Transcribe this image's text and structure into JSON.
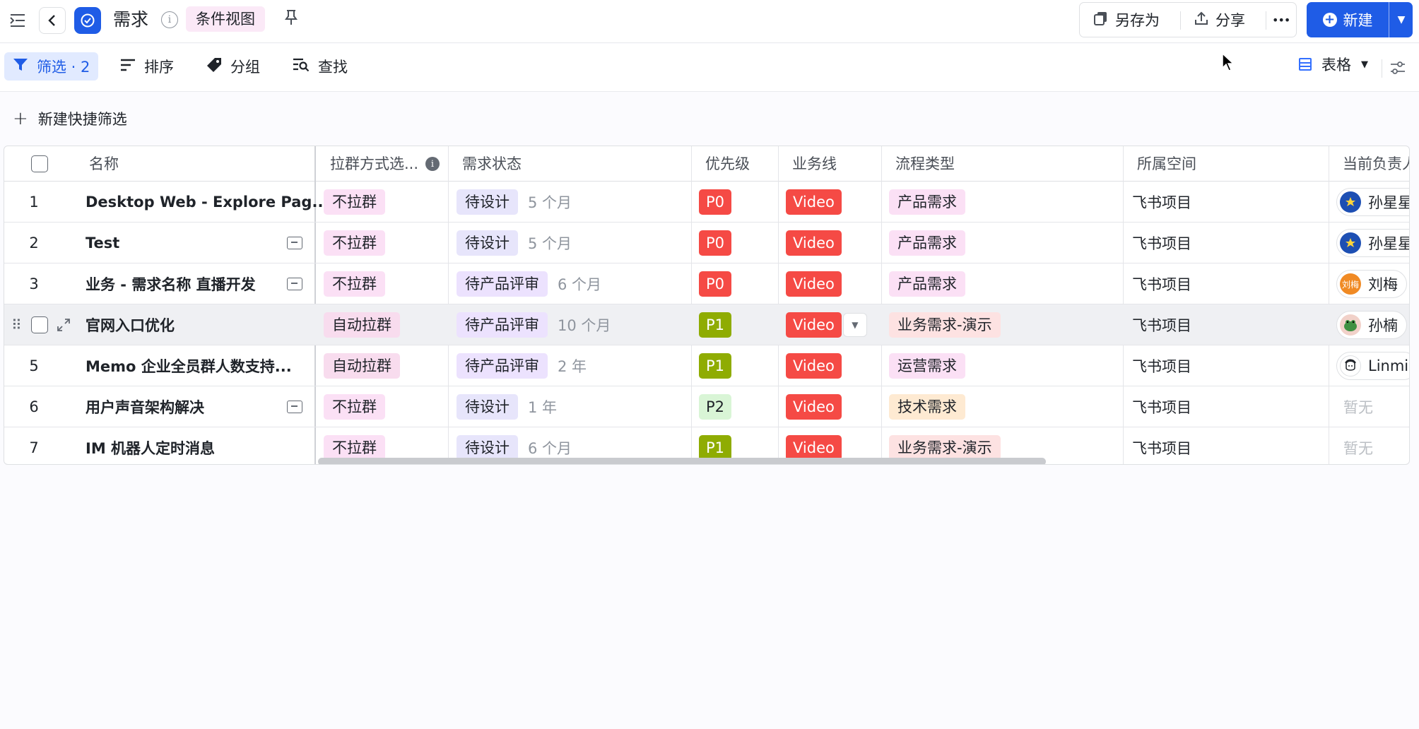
{
  "header": {
    "title": "需求",
    "view_name": "条件视图",
    "save_as": "另存为",
    "share": "分享",
    "more": "•••",
    "new": "新建"
  },
  "toolbar": {
    "filter": "筛选 · 2",
    "sort": "排序",
    "group": "分组",
    "find": "查找",
    "view_type": "表格"
  },
  "quick_filter": {
    "label": "新建快捷筛选"
  },
  "table": {
    "columns": [
      "名称",
      "拉群方式选...",
      "需求状态",
      "优先级",
      "业务线",
      "流程类型",
      "所属空间",
      "当前负责人"
    ],
    "rows": [
      {
        "idx": "1",
        "name": "Desktop Web - Explore Pag...",
        "comment": false,
        "pull": "不拉群",
        "status": "待设计",
        "age": "5 个月",
        "priority": "P0",
        "line": "Video",
        "flow": "产品需求",
        "space": "飞书项目",
        "owner": "孙星星",
        "owner_avatar": "star"
      },
      {
        "idx": "2",
        "name": "Test",
        "comment": true,
        "pull": "不拉群",
        "status": "待设计",
        "age": "5 个月",
        "priority": "P0",
        "line": "Video",
        "flow": "产品需求",
        "space": "飞书项目",
        "owner": "孙星星",
        "owner_avatar": "star"
      },
      {
        "idx": "3",
        "name": "业务 - 需求名称 直播开发",
        "comment": true,
        "pull": "不拉群",
        "status": "待产品评审",
        "age": "6 个月",
        "priority": "P0",
        "line": "Video",
        "flow": "产品需求",
        "space": "飞书项目",
        "owner": "刘梅",
        "owner_avatar": "刘梅"
      },
      {
        "idx": "",
        "name": "官网入口优化",
        "comment": false,
        "pull": "自动拉群",
        "status": "待产品评审",
        "age": "10 个月",
        "priority": "P1",
        "line": "Video",
        "flow": "业务需求-演示",
        "space": "飞书项目",
        "owner": "孙楠",
        "owner_avatar": "frog"
      },
      {
        "idx": "5",
        "name": "Memo 企业全员群人数支持...",
        "comment": false,
        "pull": "自动拉群",
        "status": "待产品评审",
        "age": "2 年",
        "priority": "P1",
        "line": "Video",
        "flow": "运营需求",
        "space": "飞书项目",
        "owner": "Linmi",
        "owner_avatar": "face"
      },
      {
        "idx": "6",
        "name": "用户声音架构解决",
        "comment": true,
        "pull": "不拉群",
        "status": "待设计",
        "age": "1 年",
        "priority": "P2",
        "line": "Video",
        "flow": "技术需求",
        "space": "飞书项目",
        "owner": "暂无",
        "owner_avatar": ""
      },
      {
        "idx": "7",
        "name": "IM 机器人定时消息",
        "comment": false,
        "pull": "不拉群",
        "status": "待设计",
        "age": "6 个月",
        "priority": "P1",
        "line": "Video",
        "flow": "业务需求-演示",
        "space": "飞书项目",
        "owner": "暂无",
        "owner_avatar": ""
      }
    ]
  },
  "colors": {
    "accent": "#1f5ce6",
    "video": "#f54a45",
    "p0": "#f54a45",
    "p1": "#8fac02",
    "p2": "#d9f5d6"
  }
}
